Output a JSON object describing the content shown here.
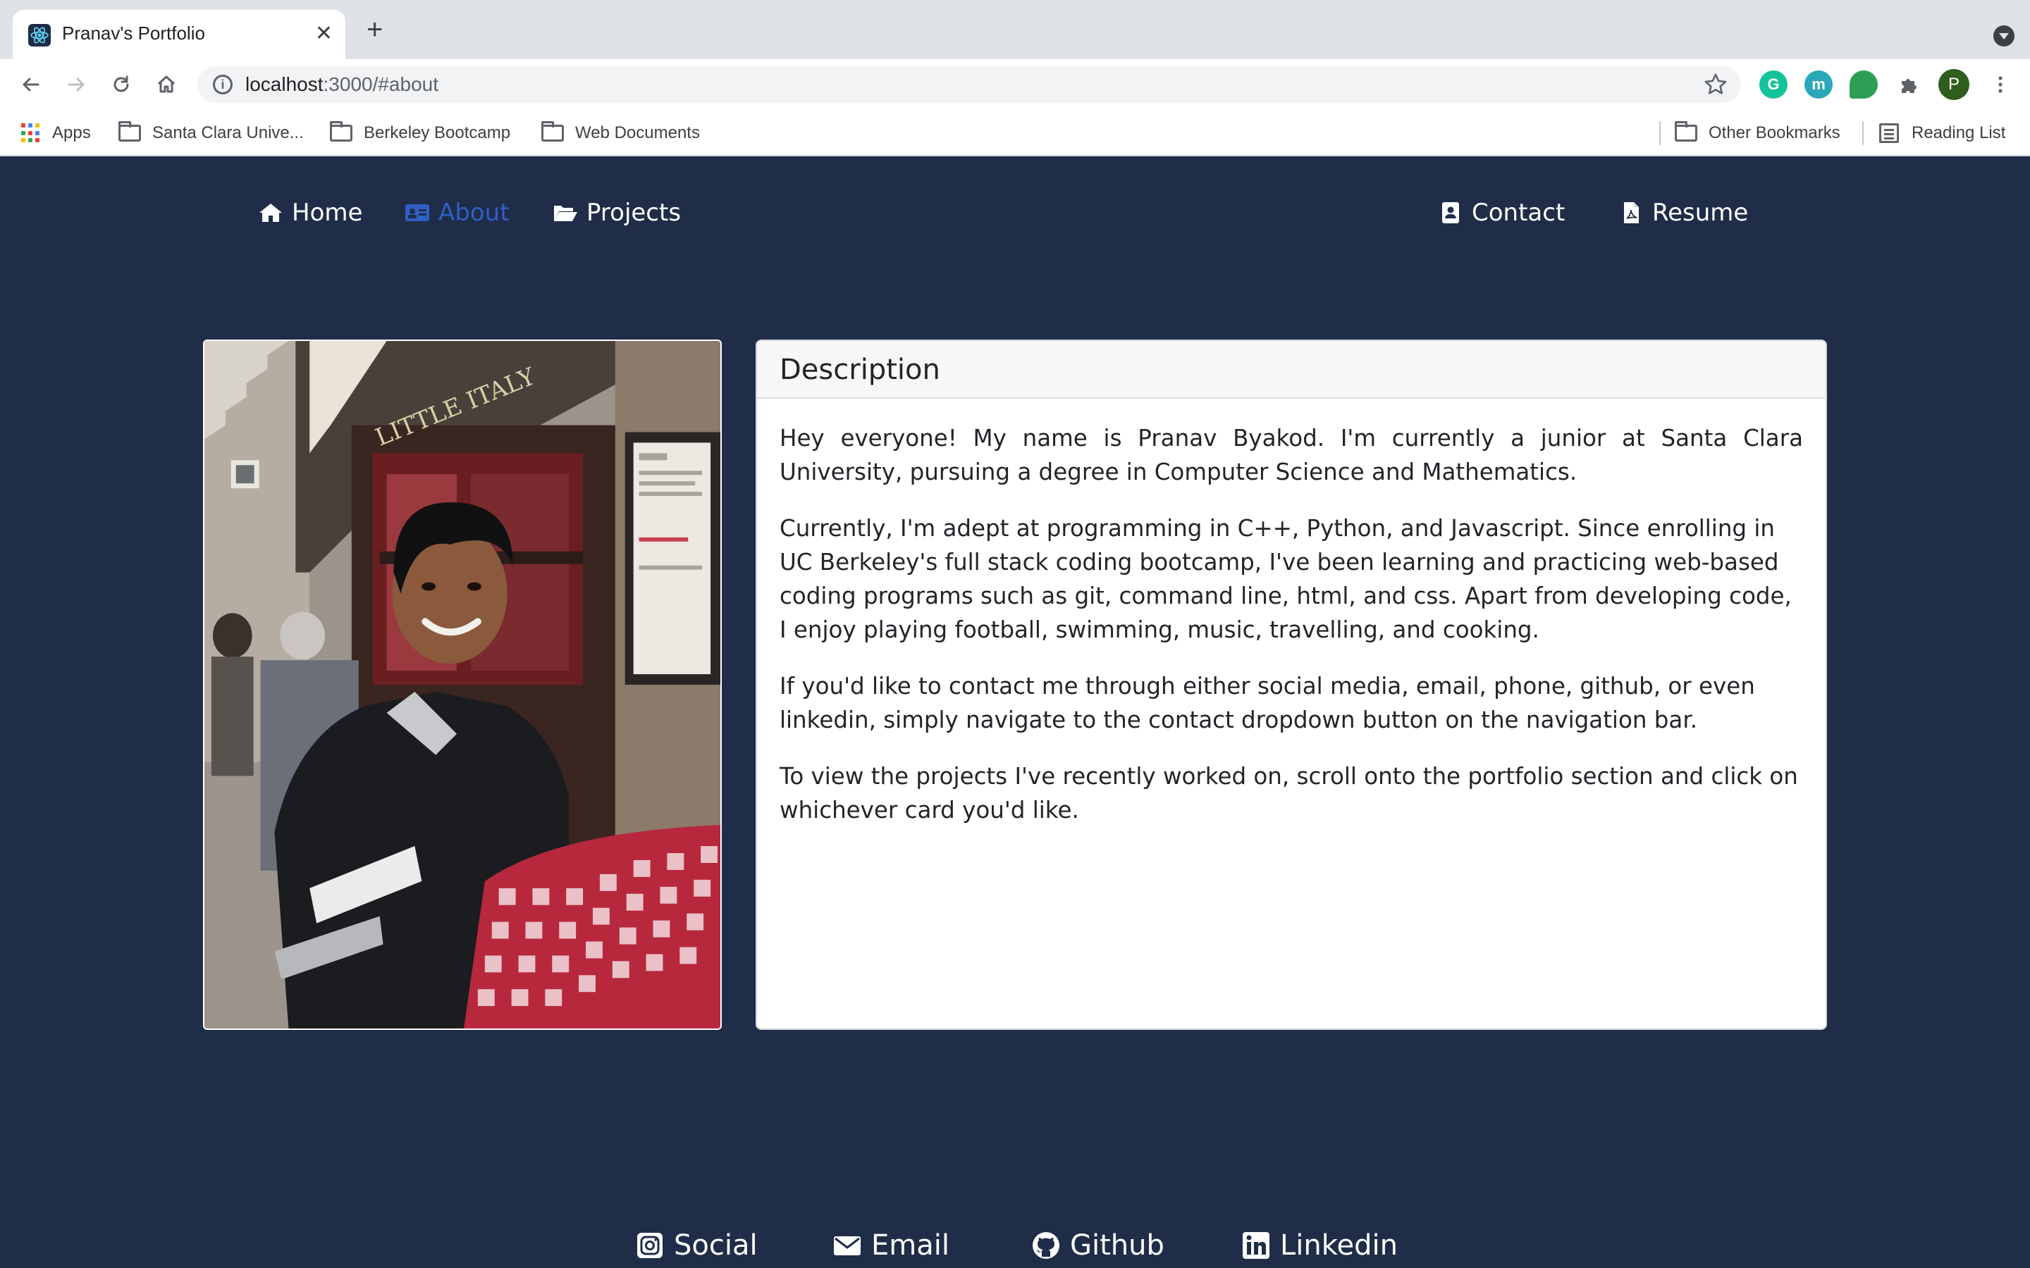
{
  "browser": {
    "tab_title": "Pranav's Portfolio",
    "tab_close": "✕",
    "new_tab": "+",
    "url_host": "localhost",
    "url_rest": ":3000/#about",
    "profile_initial": "P",
    "ext_m": "m",
    "ext_g": "G",
    "bookmarks": [
      {
        "label": "Apps"
      },
      {
        "label": "Santa Clara Unive..."
      },
      {
        "label": "Berkeley Bootcamp"
      },
      {
        "label": "Web Documents"
      }
    ],
    "other_bookmarks": "Other Bookmarks",
    "reading_list": "Reading List"
  },
  "nav": {
    "home": "Home",
    "about": "About",
    "projects": "Projects",
    "contact": "Contact",
    "resume": "Resume"
  },
  "about": {
    "header": "Description",
    "paragraphs": [
      "Hey everyone! My name is Pranav Byakod. I'm currently a junior at Santa Clara University, pursuing a degree in Computer Science and Mathematics.",
      "Currently, I'm adept at programming in C++, Python, and Javascript. Since enrolling in UC Berkeley's full stack coding bootcamp, I've been learning and practicing web-based coding programs such as git, command line, html, and css. Apart from developing code, I enjoy playing football, swimming, music, travelling, and cooking.",
      "If you'd like to contact me through either social media, email, phone, github, or even linkedin, simply navigate to the contact dropdown button on the navigation bar.",
      "To view the projects I've recently worked on, scroll onto the portfolio section and click on whichever card you'd like."
    ]
  },
  "footer": {
    "social": "Social",
    "email": "Email",
    "github": "Github",
    "linkedin": "Linkedin"
  },
  "colors": {
    "page_bg": "#1f2d48",
    "active_nav": "#2f5fc4"
  }
}
